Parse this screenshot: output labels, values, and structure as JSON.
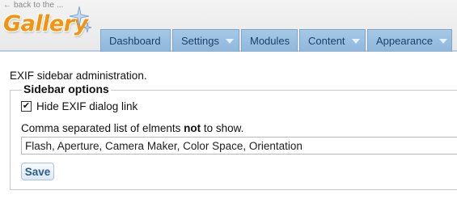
{
  "header": {
    "back_link": "← back to the ...",
    "logo_text": "Gallery",
    "colors": {
      "tab_bg": "#9fc3e3",
      "tab_text": "#1f3f68",
      "logo_orange": "#f39410"
    }
  },
  "nav": {
    "tabs": [
      {
        "label": "Dashboard",
        "has_menu": false
      },
      {
        "label": "Settings",
        "has_menu": true
      },
      {
        "label": "Modules",
        "has_menu": false
      },
      {
        "label": "Content",
        "has_menu": true
      },
      {
        "label": "Appearance",
        "has_menu": true
      }
    ]
  },
  "page": {
    "intro": "EXIF sidebar administration.",
    "fieldset_legend": "Sidebar options",
    "hide_checkbox": {
      "label": "Hide EXIF dialog link",
      "checked": true
    },
    "comma_label_before": "Comma separated list of elments ",
    "comma_label_bold": "not",
    "comma_label_after": " to show.",
    "elements_value": "Flash, Aperture, Camera Maker, Color Space, Orientation",
    "save_label": "Save"
  }
}
